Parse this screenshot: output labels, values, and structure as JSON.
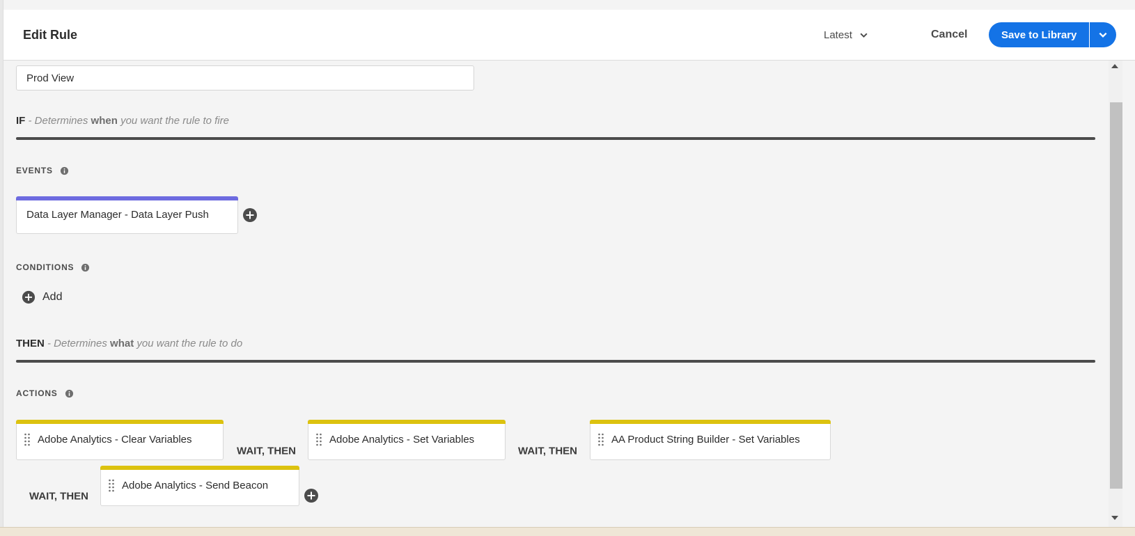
{
  "header": {
    "title": "Edit Rule",
    "version_label": "Latest",
    "cancel_label": "Cancel",
    "save_label": "Save to Library"
  },
  "rule_name": {
    "value": "Prod View"
  },
  "if_section": {
    "keyword": "IF",
    "desc_prefix": "- Determines",
    "desc_emph": "when",
    "desc_suffix": "you want the rule to fire"
  },
  "events": {
    "label": "EVENTS",
    "items": [
      {
        "label": "Data Layer Manager - Data Layer Push"
      }
    ]
  },
  "conditions": {
    "label": "CONDITIONS",
    "add_label": "Add"
  },
  "then_section": {
    "keyword": "THEN",
    "desc_prefix": "- Determines",
    "desc_emph": "what",
    "desc_suffix": "you want the rule to do"
  },
  "actions": {
    "label": "ACTIONS",
    "connector": "WAIT, THEN",
    "items": [
      {
        "label": "Adobe Analytics - Clear Variables"
      },
      {
        "label": "Adobe Analytics - Set Variables"
      },
      {
        "label": "AA Product String Builder - Set Variables"
      },
      {
        "label": "Adobe Analytics - Send Beacon"
      }
    ]
  },
  "colors": {
    "primary_blue": "#1473e6",
    "event_bar": "#6d6be0",
    "action_bar": "#dcc20f"
  },
  "icons": [
    "chevron-down-icon",
    "info-icon",
    "plus-circle-icon",
    "drag-handle-icon"
  ]
}
